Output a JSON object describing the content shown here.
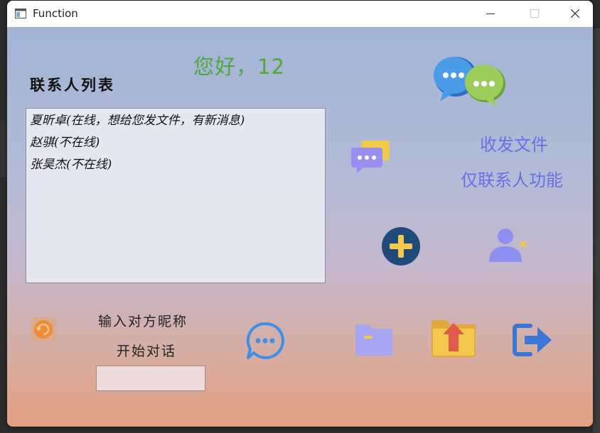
{
  "window": {
    "title": "Function"
  },
  "titlebar": {
    "minimize_icon": "minimize-icon",
    "maximize_icon": "maximize-icon",
    "close_icon": "close-icon"
  },
  "header": {
    "greeting": "您好，12"
  },
  "contacts": {
    "title": "联系人列表",
    "items": [
      "夏昕卓(在线，想给您发文件，有新消息)",
      "赵骐(不在线)",
      "张昊杰(不在线)"
    ]
  },
  "features": {
    "line1": "收发文件",
    "line2": "仅联系人功能"
  },
  "chat_start": {
    "prompt_line1": "输入对方昵称",
    "prompt_line2": "开始对话",
    "nickname_value": ""
  },
  "icons": {
    "logo": "chat-bubbles-logo-icon",
    "message": "message-bubble-icon",
    "add": "add-contact-plus-icon",
    "remove": "remove-user-icon",
    "refresh": "refresh-icon",
    "chat": "chat-start-icon",
    "folder": "folder-icon",
    "upload": "upload-file-icon",
    "logout": "logout-icon"
  },
  "colors": {
    "greeting": "#4fa83a",
    "feature_text": "#6a6fe6",
    "accent_blue": "#3b8fe8",
    "accent_green": "#8cc34b",
    "folder_purple": "#a8a6f2",
    "upload_yellow": "#f2c94c",
    "upload_red": "#e05a4e"
  }
}
